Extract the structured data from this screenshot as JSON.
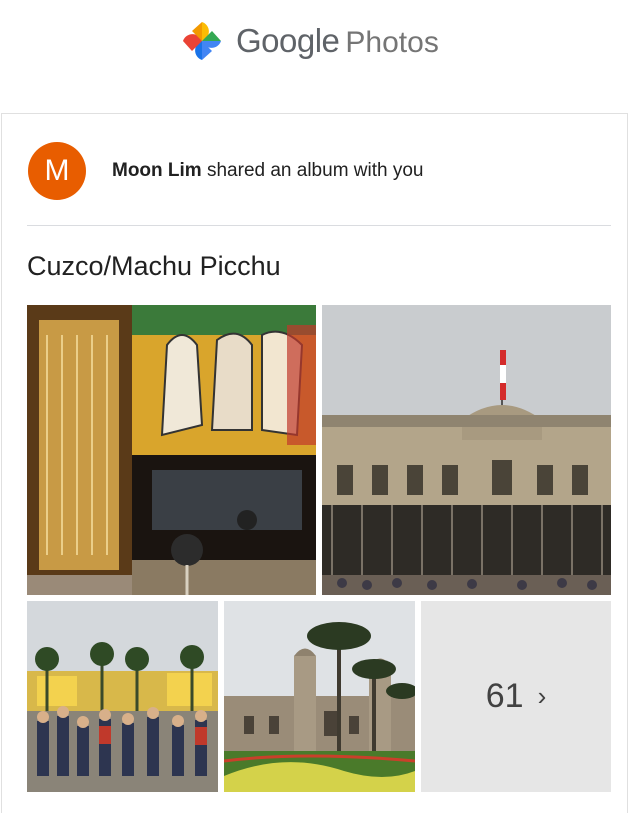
{
  "header": {
    "brand_google": "Google",
    "brand_photos": "Photos",
    "logo_icon": "google-photos-pinwheel"
  },
  "share": {
    "avatar_letter": "M",
    "sender_name": "Moon Lim",
    "message": " shared an album with you"
  },
  "album": {
    "title": "Cuzco/Machu Picchu",
    "more_count": "61",
    "more_chevron": "›"
  },
  "colors": {
    "avatar_bg": "#e85d00",
    "brand_text": "#5f6368",
    "more_tile_bg": "#e6e6e6"
  }
}
